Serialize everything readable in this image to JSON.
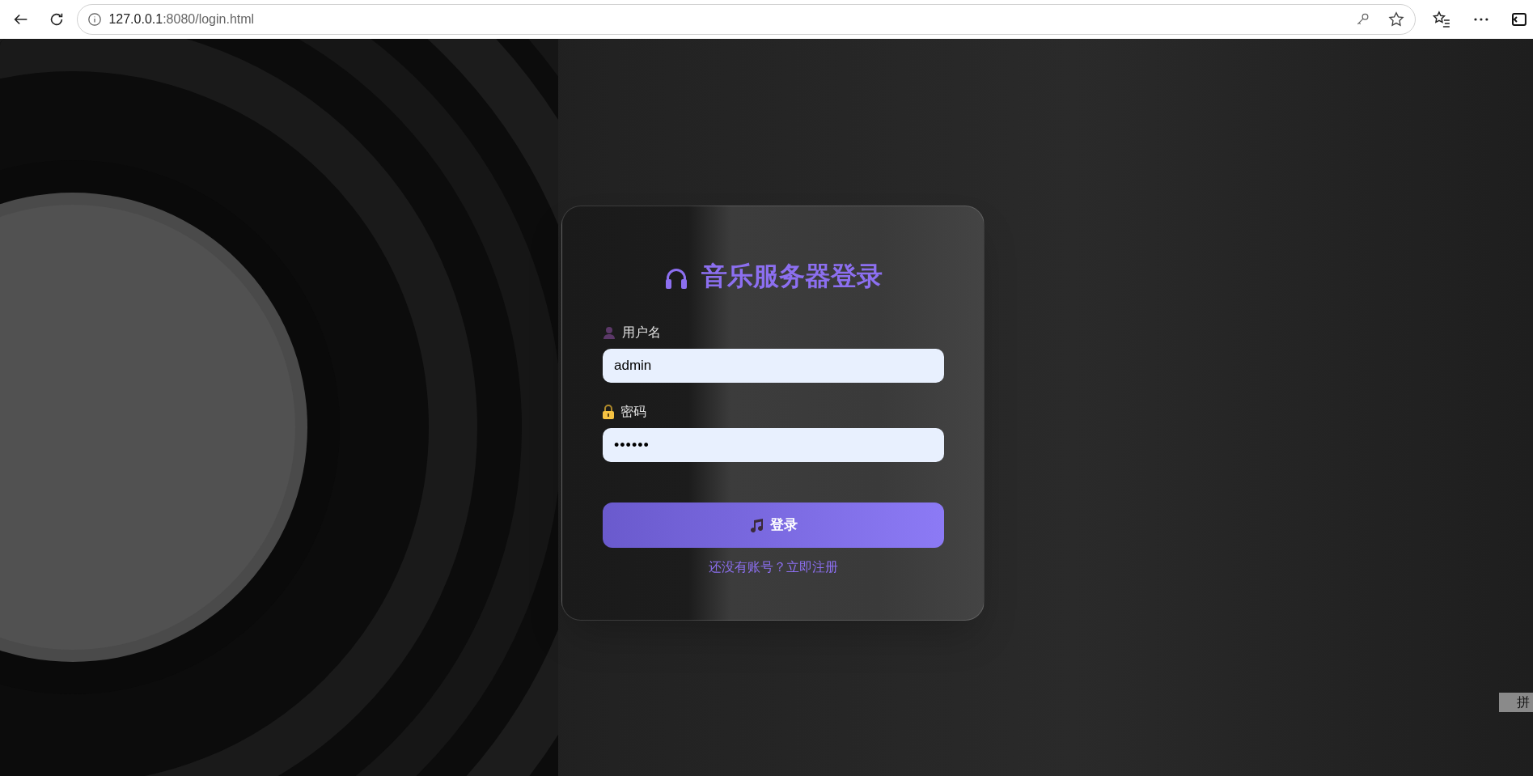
{
  "browser": {
    "url_host": "127.0.0.1",
    "url_path": ":8080/login.html"
  },
  "login": {
    "title": "音乐服务器登录",
    "fields": [
      {
        "kind": "text",
        "label": "用户名",
        "value": "admin"
      },
      {
        "kind": "password",
        "label": "密码",
        "value": "••••••"
      }
    ],
    "submit": "登录",
    "register_link": "还没有账号？立即注册"
  },
  "ime_indicator": "拼"
}
